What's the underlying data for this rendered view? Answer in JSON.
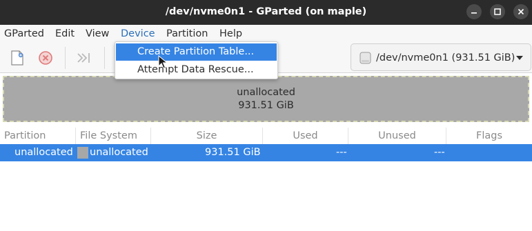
{
  "window": {
    "title": "/dev/nvme0n1 - GParted (on maple)"
  },
  "menubar": {
    "items": [
      "GParted",
      "Edit",
      "View",
      "Device",
      "Partition",
      "Help"
    ],
    "active": "Device"
  },
  "toolbar": {
    "icons": [
      "new-partition-icon",
      "delete-icon",
      "apply-icon"
    ],
    "device_selector": {
      "label": "/dev/nvme0n1 (931.51 GiB)"
    }
  },
  "disk_map": {
    "label": "unallocated",
    "size": "931.51 GiB"
  },
  "table": {
    "columns": [
      "Partition",
      "File System",
      "Size",
      "Used",
      "Unused",
      "Flags"
    ],
    "rows": [
      {
        "partition": "unallocated",
        "file_system": "unallocated",
        "size": "931.51 GiB",
        "used": "---",
        "unused": "---",
        "flags": ""
      }
    ]
  },
  "device_menu": {
    "items": [
      "Create Partition Table...",
      "Attempt Data Rescue..."
    ],
    "highlighted": "Create Partition Table..."
  },
  "colors": {
    "titlebar": "#2b2b2b",
    "selection": "#3584e4",
    "unallocated": "#a8a8a8",
    "menu_active": "#2a6fb8"
  }
}
